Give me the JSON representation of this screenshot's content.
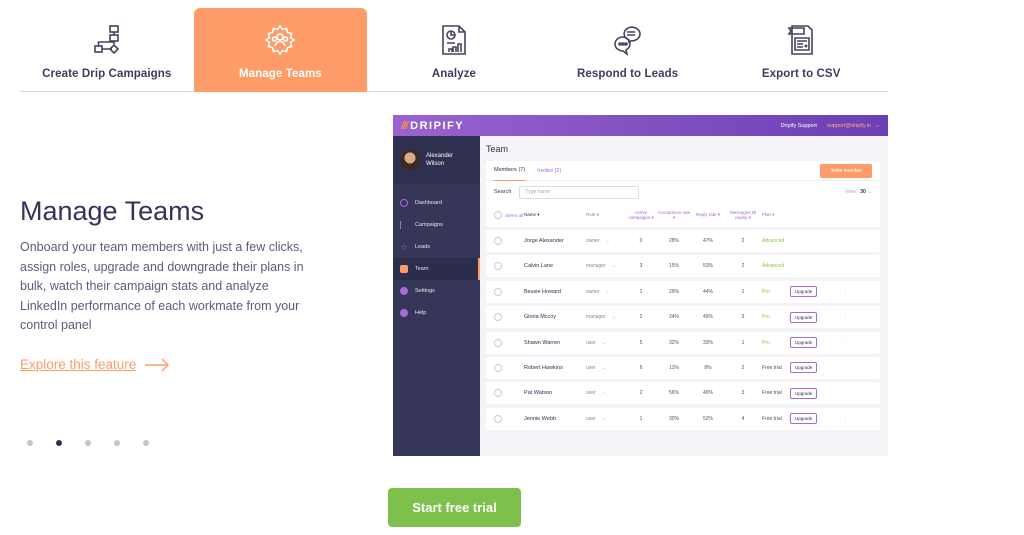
{
  "tabs": [
    {
      "label": "Create Drip Campaigns",
      "icon": "flowchart-icon",
      "active": false
    },
    {
      "label": "Manage Teams",
      "icon": "team-gear-icon",
      "active": true
    },
    {
      "label": "Analyze",
      "icon": "report-chart-icon",
      "active": false
    },
    {
      "label": "Respond to Leads",
      "icon": "chat-bubbles-icon",
      "active": false
    },
    {
      "label": "Export to CSV",
      "icon": "csv-file-icon",
      "active": false
    }
  ],
  "feature": {
    "title": "Manage Teams",
    "description": "Onboard your team members with just a few clicks, assign roles, upgrade and downgrade their plans in bulk, watch their campaign stats and analyze LinkedIn performance of each workmate from your control panel",
    "link_label": "Explore this feature"
  },
  "carousel": {
    "count": 5,
    "active_index": 1
  },
  "app": {
    "brand": "DRIPIFY",
    "support_label": "Dripify Support",
    "support_email": "support@dripify.io",
    "user_name_line1": "Alexander",
    "user_name_line2": "Wilson",
    "nav": [
      {
        "label": "Dashboard",
        "icon": "dashboard-icon"
      },
      {
        "label": "Campaigns",
        "icon": "flag-icon"
      },
      {
        "label": "Leads",
        "icon": "star-icon"
      },
      {
        "label": "Team",
        "icon": "team-icon",
        "active": true
      },
      {
        "label": "Settings",
        "icon": "gear-icon"
      },
      {
        "label": "Help",
        "icon": "help-icon"
      }
    ],
    "page_title": "Team",
    "tab_members": "Members (7)",
    "tab_invites": "Invites (2)",
    "invite_button": "Invite member",
    "search_label": "Search",
    "search_placeholder": "Type name",
    "view_label": "View:",
    "view_value": "30",
    "columns": {
      "select_all": "Select all",
      "name": "Name ▾",
      "role": "Role ▾",
      "active_campaigns": "Active campaigns ▾",
      "acceptance_rate": "Acceptance rate ▾",
      "reply_rate": "Reply rate ▾",
      "messages_till_replay": "Messages till replay ▾",
      "plan": "Plan ▾"
    },
    "upgrade_label": "Upgrade",
    "rows": [
      {
        "name": "Jorge Alexander",
        "role": "owner",
        "active": "0",
        "acceptance": "28%",
        "reply": "47%",
        "messages": "2",
        "plan": "Advanced",
        "plan_class": "plan-adv",
        "upgrade": false
      },
      {
        "name": "Calvin Lane",
        "role": "manager",
        "active": "3",
        "acceptance": "15%",
        "reply": "53%",
        "messages": "2",
        "plan": "Advanced",
        "plan_class": "plan-adv",
        "upgrade": false
      },
      {
        "name": "Bessie Howard",
        "role": "owner",
        "active": "1",
        "acceptance": "29%",
        "reply": "44%",
        "messages": "1",
        "plan": "Pro",
        "plan_class": "plan-pro",
        "upgrade": true
      },
      {
        "name": "Gloria Mccoy",
        "role": "manager",
        "active": "2",
        "acceptance": "24%",
        "reply": "49%",
        "messages": "3",
        "plan": "Pro",
        "plan_class": "plan-pro",
        "upgrade": true
      },
      {
        "name": "Shawn Warren",
        "role": "user",
        "active": "5",
        "acceptance": "32%",
        "reply": "33%",
        "messages": "1",
        "plan": "Pro",
        "plan_class": "plan-pro",
        "upgrade": true
      },
      {
        "name": "Robert Hawkins",
        "role": "user",
        "active": "6",
        "acceptance": "11%",
        "reply": "8%",
        "messages": "2",
        "plan": "Free trial",
        "plan_class": "plan-free",
        "upgrade": true
      },
      {
        "name": "Pat Watson",
        "role": "user",
        "active": "2",
        "acceptance": "56%",
        "reply": "49%",
        "messages": "3",
        "plan": "Free trial",
        "plan_class": "plan-free",
        "upgrade": true
      },
      {
        "name": "Jennie Webb",
        "role": "user",
        "active": "1",
        "acceptance": "30%",
        "reply": "52%",
        "messages": "4",
        "plan": "Free trial",
        "plan_class": "plan-free",
        "upgrade": true
      }
    ]
  },
  "cta_label": "Start free trial",
  "colors": {
    "accent_orange": "#fd9c68",
    "cta_green": "#7dc04b",
    "brand_purple": "#8a55c8",
    "text_dark": "#34345a"
  }
}
